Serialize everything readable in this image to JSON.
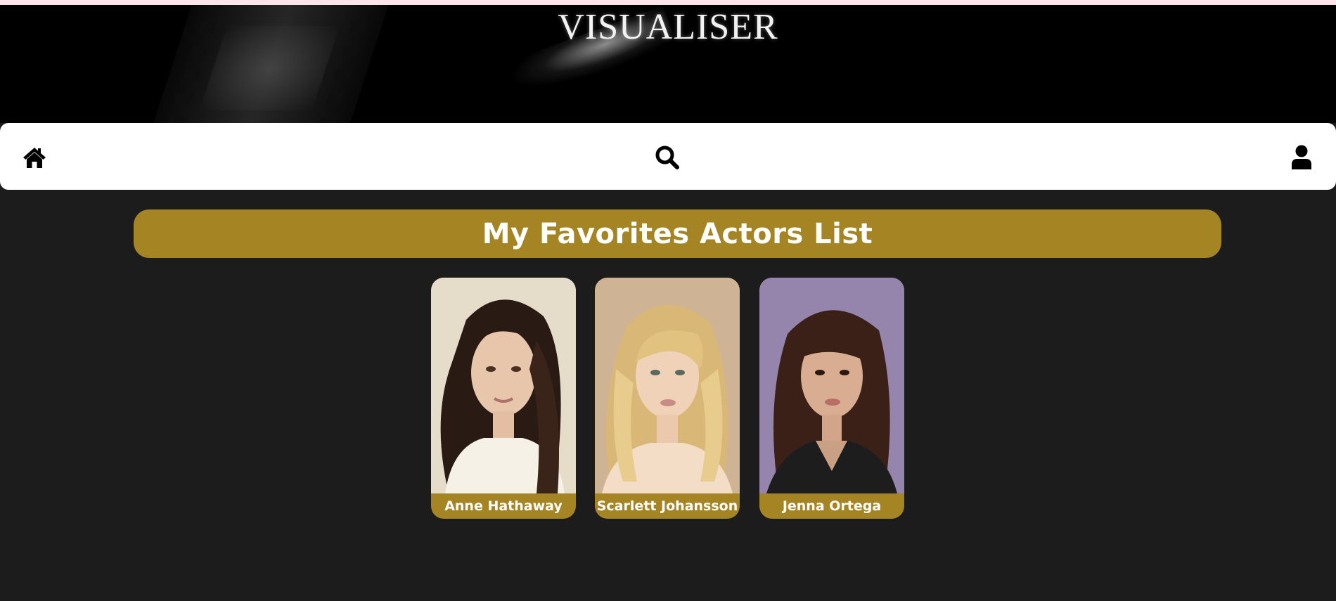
{
  "header": {
    "site_title": "VISUALISER"
  },
  "nav": {
    "icons": [
      "home-icon",
      "search-icon",
      "user-icon"
    ]
  },
  "main": {
    "heading": "My Favorites Actors List",
    "actors": [
      {
        "name": "Anne Hathaway"
      },
      {
        "name": "Scarlett Johansson"
      },
      {
        "name": "Jenna Ortega"
      }
    ]
  },
  "colors": {
    "accent": "#a58424",
    "page_background": "#1c1c1c",
    "banner_background": "#000000",
    "nav_background": "#ffffff"
  }
}
